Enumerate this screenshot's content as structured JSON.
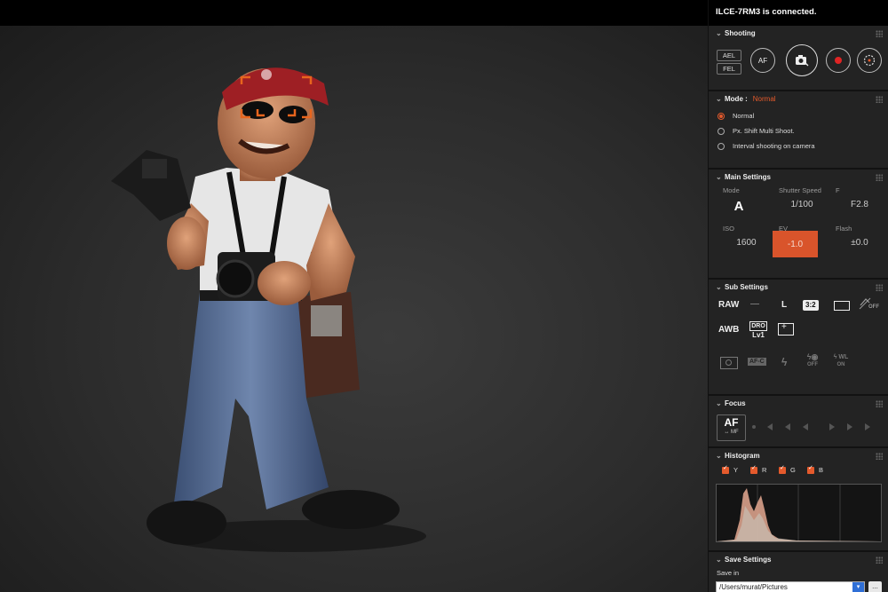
{
  "status": {
    "connected_text": "ILCE-7RM3 is connected."
  },
  "shooting": {
    "title": "Shooting",
    "ael": "AEL",
    "fel": "FEL",
    "af": "AF"
  },
  "mode": {
    "title": "Mode :",
    "current": "Normal",
    "options": [
      "Normal",
      "Px. Shift Multi Shoot.",
      "Interval shooting on camera"
    ],
    "selected_index": 0
  },
  "main_settings": {
    "title": "Main Settings",
    "mode_label": "Mode",
    "mode_value": "A",
    "shutter_label": "Shutter Speed",
    "shutter_value": "1/100",
    "f_label": "F",
    "f_value": "F2.8",
    "iso_label": "ISO",
    "iso_value": "1600",
    "ev_label": "EV",
    "ev_value": "-1.0",
    "flash_label": "Flash",
    "flash_value": "±0.0"
  },
  "sub_settings": {
    "title": "Sub Settings",
    "file_format": "RAW",
    "dash": "—",
    "image_size": "L",
    "aspect": "3:2",
    "wb": "AWB",
    "dro_top": "DRO",
    "dro_bottom": "Lv1",
    "off": "OFF",
    "on": "ON",
    "afc": "AF-C",
    "wl": "WL"
  },
  "focus": {
    "title": "Focus",
    "af_label": "AF",
    "mf_label": "MF"
  },
  "histogram": {
    "title": "Histogram",
    "channels": [
      "Y",
      "R",
      "G",
      "B"
    ]
  },
  "save_settings": {
    "title": "Save Settings",
    "save_in_label": "Save in",
    "path": "/Users/murat/Pictures",
    "more_label": "..."
  },
  "colors": {
    "accent": "#e45a2c",
    "ev_highlight": "#d9542b",
    "panel_bg": "#232323"
  }
}
